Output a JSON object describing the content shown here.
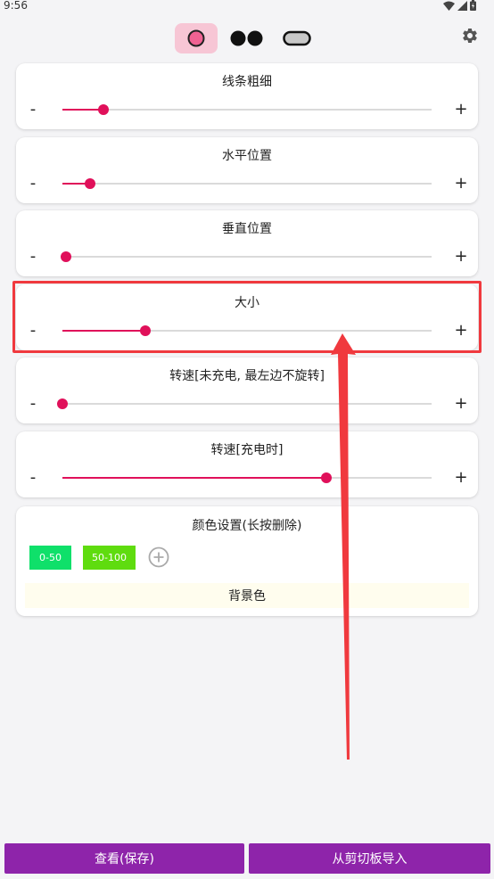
{
  "status": {
    "time": "9:56",
    "icons": [
      "wifi-icon",
      "signal-icon",
      "battery-icon"
    ]
  },
  "mode_tabs": [
    {
      "icon": "single-circle-icon",
      "active": true
    },
    {
      "icon": "double-circle-icon",
      "active": false
    },
    {
      "icon": "pill-icon",
      "active": false
    }
  ],
  "settings_icon": "gear-icon",
  "sliders": [
    {
      "title": "线条粗细",
      "value": 0.11
    },
    {
      "title": "水平位置",
      "value": 0.075
    },
    {
      "title": "垂直位置",
      "value": 0.01
    },
    {
      "title": "大小",
      "value": 0.225
    },
    {
      "title": "转速[未充电, 最左边不旋转]",
      "value": 0.0
    },
    {
      "title": "转速[充电时]",
      "value": 0.715
    }
  ],
  "slider_controls": {
    "minus": "-",
    "plus": "+"
  },
  "color_settings": {
    "title": "颜色设置(长按删除)",
    "ranges": [
      {
        "label": "0-50",
        "color": "#0fe06a"
      },
      {
        "label": "50-100",
        "color": "#5fdc0f"
      }
    ],
    "add_icon": "add-circle-icon",
    "background_label": "背景色"
  },
  "bottom_buttons": {
    "view_save": "查看(保存)",
    "import_clipboard": "从剪切板导入"
  },
  "colors": {
    "accent": "#e0105a",
    "primary": "#8e24aa",
    "highlight": "#f0393e",
    "active_tab": "#f7c6d5"
  }
}
